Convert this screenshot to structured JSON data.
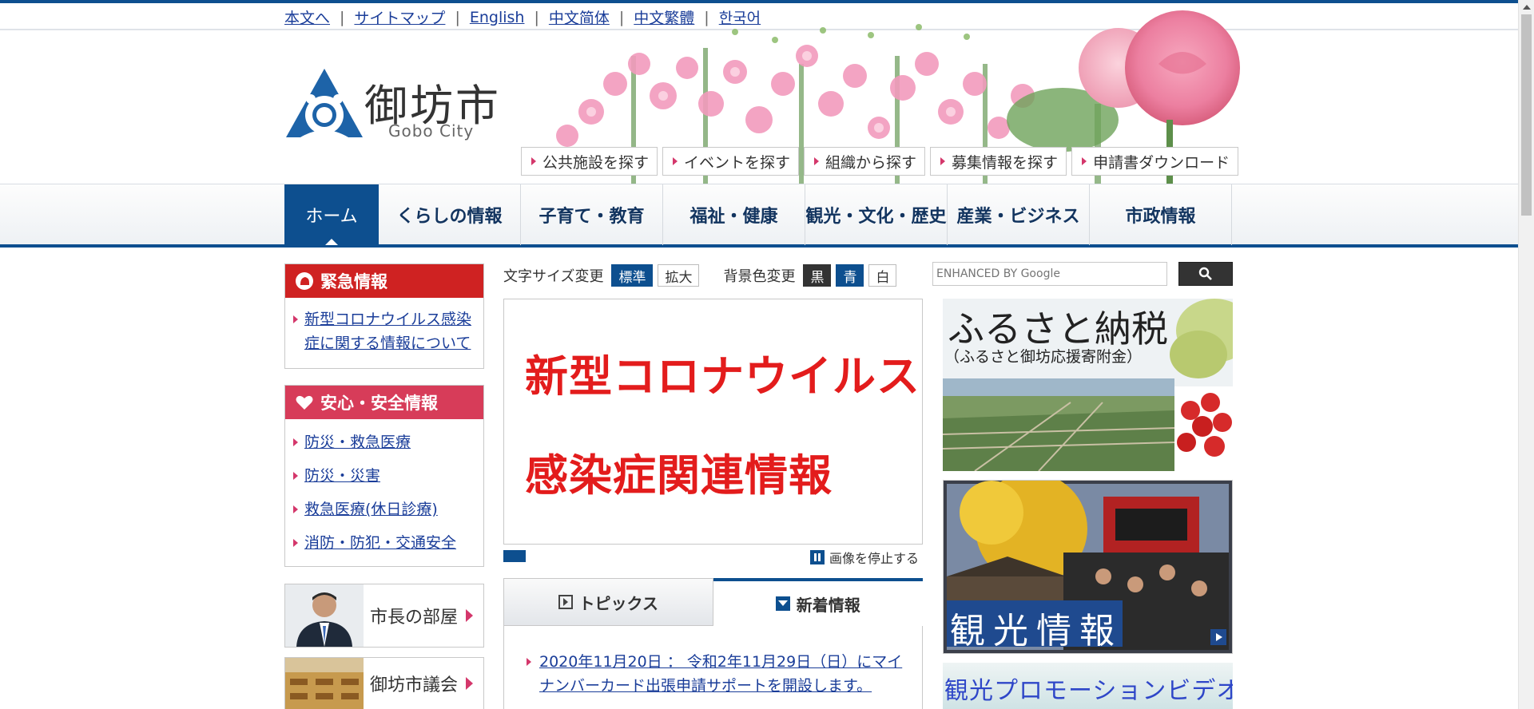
{
  "util_links": [
    "本文へ",
    "サイトマップ",
    "English",
    "中文简体",
    "中文繁體",
    "한국어"
  ],
  "util_sep": "|",
  "logo": {
    "name": "御坊市",
    "sub": "Gobo City"
  },
  "quick_links": [
    "公共施設を探す",
    "イベントを探す",
    "組織から探す",
    "募集情報を探す",
    "申請書ダウンロード"
  ],
  "nav": [
    "ホーム",
    "くらしの情報",
    "子育て・教育",
    "福祉・健康",
    "観光・文化・歴史",
    "産業・ビジネス",
    "市政情報"
  ],
  "emergency": {
    "title": "緊急情報",
    "items": [
      "新型コロナウイルス感染症に関する情報について"
    ]
  },
  "safety": {
    "title": "安心・安全情報",
    "items": [
      "防災・救急医療",
      "防災・災害",
      "救急医療(休日診療)",
      "消防・防犯・交通安全"
    ]
  },
  "portals": [
    "市長の部屋",
    "御坊市議会"
  ],
  "tools": {
    "font_label": "文字サイズ変更",
    "font_normal": "標準",
    "font_large": "拡大",
    "bg_label": "背景色変更",
    "bg_black": "黒",
    "bg_blue": "青",
    "bg_white": "白"
  },
  "slide": {
    "line1": "新型コロナウイルス",
    "line2": "感染症関連情報"
  },
  "pause_label": "画像を停止する",
  "tabs": {
    "topics": "トピックス",
    "news": "新着情報"
  },
  "news_item": "2020年11月20日 ： 令和2年11月29日（日）にマイナンバーカード出張申請サポートを開設します。",
  "search": {
    "placeholder": "ENHANCED BY Google"
  },
  "banners": {
    "furusato_title": "ふるさと納税",
    "furusato_sub": "（ふるさと御坊応援寄附金）",
    "kanko": [
      "観",
      "光",
      "情",
      "報"
    ],
    "promo": "観光プロモーションビデオ"
  },
  "colors": {
    "brand": "#0d4f8f",
    "emergency": "#cf2222",
    "safety": "#d73c59",
    "accent_pink": "#d4376b"
  }
}
